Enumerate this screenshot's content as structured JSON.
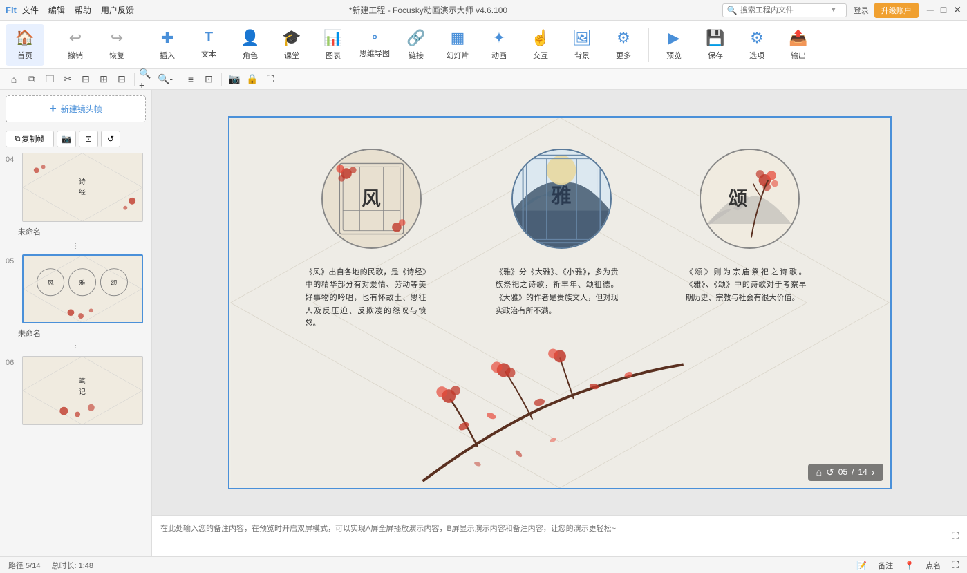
{
  "titlebar": {
    "app_label": "FIt",
    "menu": [
      "文件",
      "编辑",
      "帮助",
      "用户反馈"
    ],
    "title": "*新建工程 - Focusky动画演示大师 v4.6.100",
    "search_placeholder": "搜索工程内文件",
    "login_label": "登录",
    "upgrade_label": "升级账户"
  },
  "toolbar": {
    "items": [
      {
        "id": "home",
        "icon": "🏠",
        "label": "首页"
      },
      {
        "id": "undo",
        "icon": "↩",
        "label": "撤销"
      },
      {
        "id": "redo",
        "icon": "↪",
        "label": "恢复"
      },
      {
        "id": "insert",
        "icon": "➕",
        "label": "插入"
      },
      {
        "id": "text",
        "icon": "T",
        "label": "文本"
      },
      {
        "id": "role",
        "icon": "👤",
        "label": "角色"
      },
      {
        "id": "class",
        "icon": "🏫",
        "label": "课堂"
      },
      {
        "id": "chart",
        "icon": "📊",
        "label": "图表"
      },
      {
        "id": "mindmap",
        "icon": "🧠",
        "label": "思维导图"
      },
      {
        "id": "link",
        "icon": "🔗",
        "label": "链接"
      },
      {
        "id": "slide",
        "icon": "🎞",
        "label": "幻灯片"
      },
      {
        "id": "animate",
        "icon": "✨",
        "label": "动画"
      },
      {
        "id": "interact",
        "icon": "🖱",
        "label": "交互"
      },
      {
        "id": "bg",
        "icon": "🖼",
        "label": "背景"
      },
      {
        "id": "more",
        "icon": "⚙",
        "label": "更多"
      },
      {
        "id": "preview",
        "icon": "▶",
        "label": "预览"
      },
      {
        "id": "save",
        "icon": "💾",
        "label": "保存"
      },
      {
        "id": "options",
        "icon": "⚙",
        "label": "选项"
      },
      {
        "id": "export",
        "icon": "📤",
        "label": "输出"
      }
    ]
  },
  "sidebar": {
    "new_frame_label": "新建镜头帧",
    "copy_frame_label": "复制帧",
    "slides": [
      {
        "number": "04",
        "label": "未命名",
        "active": false
      },
      {
        "number": "05",
        "label": "未命名",
        "active": true
      },
      {
        "number": "06",
        "label": "",
        "active": false
      }
    ]
  },
  "canvas": {
    "slide_number": "5",
    "circles": [
      {
        "char": "风",
        "description": "《风》出自各地的民歌，是《诗经》中的精华部分有对爱情、劳动等美好事物的吟唱，也有怀故土、思征人及反压迫、反欺凌的怨叹与愤怒。"
      },
      {
        "char": "雅",
        "description": "《雅》分《大雅》、《小雅》，多为贵族祭祀之诗歌，祈丰年、颂祖德。《大雅》的作者是贵族文人，但对现实政治有所不满。"
      },
      {
        "char": "颂",
        "description": "《颂》则为宗庙祭祀之诗歌。《雅》、《颂》中的诗歌对于考察早期历史、宗教与社会有很大价值。"
      }
    ]
  },
  "page_counter": {
    "current": "05",
    "total": "14",
    "separator": "/"
  },
  "notes": {
    "placeholder": "在此处输入您的备注内容，在预览时开启双屏模式，可以实现A屏全屏播放演示内容，B屏显示演示内容和备注内容，让您的演示更轻松~"
  },
  "statusbar": {
    "path": "路径 5/14",
    "duration": "总时长: 1:48",
    "note_label": "备注",
    "point_label": "点名"
  }
}
